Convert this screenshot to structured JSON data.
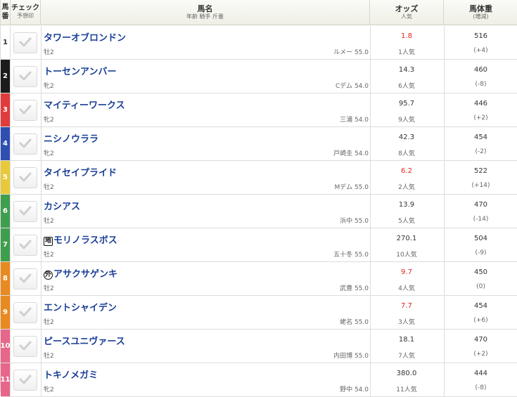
{
  "header": {
    "umaban": "馬番",
    "check": "チェック",
    "check_sub": "予想印",
    "horse": "馬名",
    "horse_sub": "年齢 騎手 斤量",
    "odds": "オッズ",
    "odds_sub": "人気",
    "weight": "馬体重",
    "weight_sub": "(増減)"
  },
  "frame_colors": [
    "#ffffff",
    "#1b1b1b",
    "#e23b3b",
    "#2e4fb0",
    "#e8c93a",
    "#3f9e4d",
    "#3f9e4d",
    "#e88a1f",
    "#e88a1f",
    "#e7668a",
    "#e7668a"
  ],
  "frame_text_colors": [
    "#333333",
    "#ffffff",
    "#ffffff",
    "#ffffff",
    "#ffffff",
    "#ffffff",
    "#ffffff",
    "#ffffff",
    "#ffffff",
    "#ffffff",
    "#ffffff"
  ],
  "hot_color": "#e0261e",
  "horses": [
    {
      "num": "1",
      "mark": "",
      "mark_shape": "",
      "name": "タワーオブロンドン",
      "sexage": "牡2",
      "jockey": "ルメー 55.0",
      "odds": "1.8",
      "hot": true,
      "pop": "1人気",
      "weight": "516",
      "change": "(+4)"
    },
    {
      "num": "2",
      "mark": "",
      "mark_shape": "",
      "name": "トーセンアンバー",
      "sexage": "牝2",
      "jockey": "Cデム 54.0",
      "odds": "14.3",
      "hot": false,
      "pop": "6人気",
      "weight": "460",
      "change": "(-8)"
    },
    {
      "num": "3",
      "mark": "",
      "mark_shape": "",
      "name": "マイティーワークス",
      "sexage": "牝2",
      "jockey": "三浦 54.0",
      "odds": "95.7",
      "hot": false,
      "pop": "9人気",
      "weight": "446",
      "change": "(+2)"
    },
    {
      "num": "4",
      "mark": "",
      "mark_shape": "",
      "name": "ニシノウララ",
      "sexage": "牝2",
      "jockey": "戸崎圭 54.0",
      "odds": "42.3",
      "hot": false,
      "pop": "8人気",
      "weight": "454",
      "change": "(-2)"
    },
    {
      "num": "5",
      "mark": "",
      "mark_shape": "",
      "name": "タイセイプライド",
      "sexage": "牡2",
      "jockey": "Mデム 55.0",
      "odds": "6.2",
      "hot": true,
      "pop": "2人気",
      "weight": "522",
      "change": "(+14)"
    },
    {
      "num": "6",
      "mark": "",
      "mark_shape": "",
      "name": "カシアス",
      "sexage": "牡2",
      "jockey": "浜中 55.0",
      "odds": "13.9",
      "hot": false,
      "pop": "5人気",
      "weight": "470",
      "change": "(-14)"
    },
    {
      "num": "7",
      "mark": "地",
      "mark_shape": "sq",
      "name": "モリノラスボス",
      "sexage": "牡2",
      "jockey": "五十冬 55.0",
      "odds": "270.1",
      "hot": false,
      "pop": "10人気",
      "weight": "504",
      "change": "(-9)"
    },
    {
      "num": "8",
      "mark": "外",
      "mark_shape": "ci",
      "name": "アサクサゲンキ",
      "sexage": "牡2",
      "jockey": "武豊 55.0",
      "odds": "9.7",
      "hot": true,
      "pop": "4人気",
      "weight": "450",
      "change": "(0)"
    },
    {
      "num": "9",
      "mark": "",
      "mark_shape": "",
      "name": "エントシャイデン",
      "sexage": "牡2",
      "jockey": "蛯名 55.0",
      "odds": "7.7",
      "hot": true,
      "pop": "3人気",
      "weight": "454",
      "change": "(+6)"
    },
    {
      "num": "10",
      "mark": "",
      "mark_shape": "",
      "name": "ピースユニヴァース",
      "sexage": "牡2",
      "jockey": "内田博 55.0",
      "odds": "18.1",
      "hot": false,
      "pop": "7人気",
      "weight": "470",
      "change": "(+2)"
    },
    {
      "num": "11",
      "mark": "",
      "mark_shape": "",
      "name": "トキノメガミ",
      "sexage": "牝2",
      "jockey": "野中 54.0",
      "odds": "380.0",
      "hot": false,
      "pop": "11人気",
      "weight": "444",
      "change": "(-8)"
    }
  ]
}
